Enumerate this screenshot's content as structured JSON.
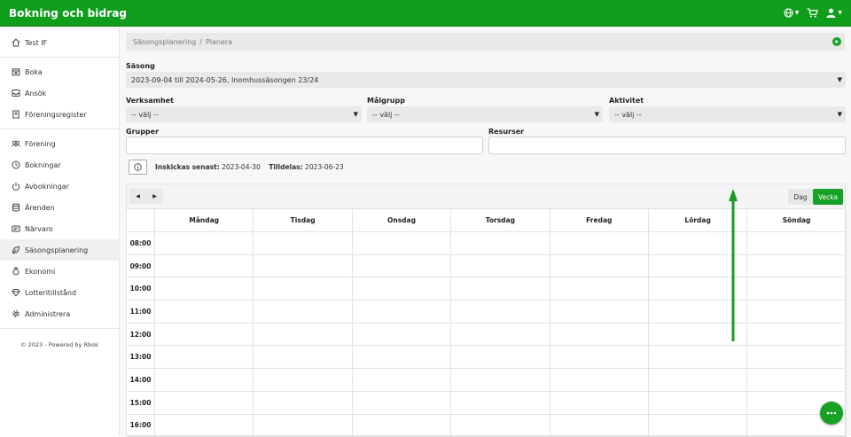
{
  "app": {
    "title": "Bokning och bidrag"
  },
  "topbar": {
    "icons": [
      "globe-icon",
      "cart-icon",
      "user-icon"
    ]
  },
  "sidebar": {
    "items": [
      {
        "label": "Test IF",
        "icon": "home-icon"
      },
      {
        "label": "Boka",
        "icon": "calendar-icon"
      },
      {
        "label": "Ansök",
        "icon": "inbox-icon"
      },
      {
        "label": "Föreningsregister",
        "icon": "book-icon"
      },
      {
        "label": "Förening",
        "icon": "users-icon"
      },
      {
        "label": "Bokningar",
        "icon": "clock-icon"
      },
      {
        "label": "Avbokningar",
        "icon": "power-icon"
      },
      {
        "label": "Ärenden",
        "icon": "database-icon"
      },
      {
        "label": "Närvaro",
        "icon": "id-card-icon"
      },
      {
        "label": "Säsongsplanering",
        "icon": "leaf-icon"
      },
      {
        "label": "Ekonomi",
        "icon": "money-bag-icon"
      },
      {
        "label": "Lotteritillstånd",
        "icon": "diamond-icon"
      },
      {
        "label": "Administrera",
        "icon": "gear-icon"
      }
    ],
    "footer": "© 2023 - Powered by Rbok"
  },
  "breadcrumb": {
    "items": [
      "Säsongsplanering",
      "Planera"
    ],
    "separator": "/"
  },
  "form": {
    "season_label": "Säsong",
    "season_value": "2023-09-04 till 2024-05-26, Inomhussäsongen 23/24",
    "verksamhet_label": "Verksamhet",
    "verksamhet_value": "-- välj --",
    "malgrupp_label": "Målgrupp",
    "malgrupp_value": "-- välj --",
    "aktivitet_label": "Aktivitet",
    "aktivitet_value": "-- välj --",
    "grupper_label": "Grupper",
    "resurser_label": "Resurser"
  },
  "info": {
    "inskickas_label": "Inskickas senast:",
    "inskickas_value": "2023-04-30",
    "tilldelas_label": "Tilldelas:",
    "tilldelas_value": "2023-06-23"
  },
  "calendar": {
    "view_day": "Dag",
    "view_week": "Vecka",
    "days": [
      "Måndag",
      "Tisdag",
      "Onsdag",
      "Torsdag",
      "Fredag",
      "Lördag",
      "Söndag"
    ],
    "times": [
      "08:00",
      "09:00",
      "10:00",
      "11:00",
      "12:00",
      "13:00",
      "14:00",
      "15:00",
      "16:00"
    ]
  },
  "colors": {
    "brand": "#0f9d1c",
    "active_view": "#17a125"
  }
}
